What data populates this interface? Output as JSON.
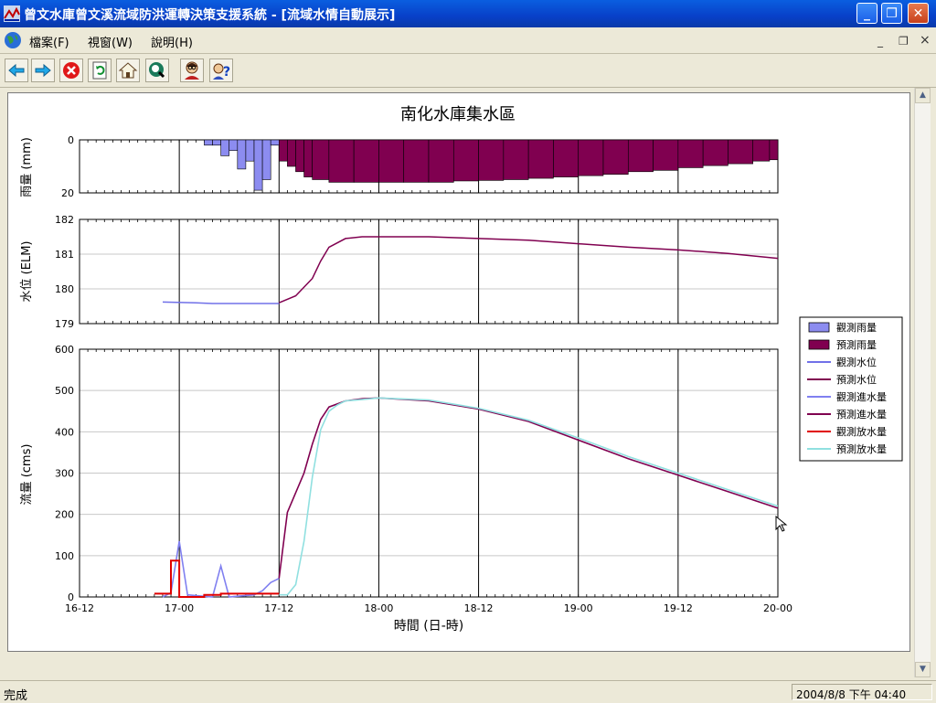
{
  "window": {
    "title": "曾文水庫曾文溪流域防洪運轉決策支援系統 - [流域水情自動展示]",
    "min_label": "_",
    "max_label": "❐",
    "close_label": "✕"
  },
  "menu": {
    "items": [
      "檔案(F)",
      "視窗(W)",
      "說明(H)"
    ],
    "mdi_min": "_",
    "mdi_restore": "❐",
    "mdi_close": "×"
  },
  "toolbar": {
    "buttons": [
      "back-icon",
      "forward-icon",
      "stop-icon",
      "refresh-icon",
      "home-icon",
      "search-icon",
      "user-icon",
      "help-icon"
    ]
  },
  "chart_data": [
    {
      "type": "bar",
      "title": "南化水庫集水區",
      "ylabel": "雨量 (mm)",
      "ylim": [
        20,
        0
      ],
      "yticks": [
        0,
        20
      ],
      "inverted": true,
      "xrange_hours": [
        0,
        84
      ],
      "series": [
        {
          "name": "觀測雨量",
          "color": "#8c8cf0",
          "x": [
            15,
            16,
            17,
            18,
            19,
            20,
            21,
            22,
            23
          ],
          "values": [
            2,
            2,
            6,
            4,
            11,
            8,
            19,
            15,
            2
          ]
        },
        {
          "name": "預測雨量",
          "color": "#800050",
          "x": [
            24,
            25,
            26,
            27,
            28,
            30,
            33,
            36,
            39,
            42,
            45,
            48,
            51,
            54,
            57,
            60,
            63,
            66,
            69,
            72,
            75,
            78,
            81,
            83
          ],
          "values": [
            8,
            10,
            12,
            14,
            15,
            16,
            16,
            16,
            16,
            16,
            15.5,
            15.3,
            15,
            14.5,
            14,
            13.5,
            13,
            12,
            11.5,
            10.5,
            9.7,
            9,
            8,
            7.5
          ]
        }
      ]
    },
    {
      "type": "line",
      "ylabel": "水位 (ELM)",
      "ylim": [
        179,
        182
      ],
      "yticks": [
        179,
        180,
        181,
        182
      ],
      "series": [
        {
          "name": "觀測水位",
          "color": "#7070e8",
          "points": [
            [
              10,
              179.62
            ],
            [
              14,
              179.6
            ],
            [
              16,
              179.58
            ],
            [
              24,
              179.58
            ]
          ]
        },
        {
          "name": "預測水位",
          "color": "#800050",
          "points": [
            [
              24,
              179.6
            ],
            [
              26,
              179.8
            ],
            [
              28,
              180.3
            ],
            [
              29,
              180.8
            ],
            [
              30,
              181.2
            ],
            [
              32,
              181.45
            ],
            [
              34,
              181.5
            ],
            [
              36,
              181.5
            ],
            [
              42,
              181.5
            ],
            [
              48,
              181.45
            ],
            [
              54,
              181.4
            ],
            [
              60,
              181.3
            ],
            [
              66,
              181.2
            ],
            [
              72,
              181.12
            ],
            [
              78,
              181.02
            ],
            [
              84,
              180.88
            ]
          ]
        }
      ]
    },
    {
      "type": "line",
      "ylabel": "流量 (cms)",
      "xlabel": "時間 (日-時)",
      "ylim": [
        0,
        600
      ],
      "yticks": [
        0,
        100,
        200,
        300,
        400,
        500,
        600
      ],
      "xticks": [
        0,
        12,
        24,
        36,
        48,
        60,
        72,
        84
      ],
      "xticklabels": [
        "16-12",
        "17-00",
        "17-12",
        "18-00",
        "18-12",
        "19-00",
        "19-12",
        "20-00"
      ],
      "series": [
        {
          "name": "觀測進水量",
          "color": "#8080f0",
          "points": [
            [
              10,
              0
            ],
            [
              11,
              10
            ],
            [
              12,
              135
            ],
            [
              13,
              5
            ],
            [
              16,
              0
            ],
            [
              17,
              75
            ],
            [
              18,
              0
            ],
            [
              21,
              5
            ],
            [
              22,
              15
            ],
            [
              23,
              35
            ],
            [
              24,
              45
            ]
          ]
        },
        {
          "name": "預測進水量",
          "color": "#800050",
          "points": [
            [
              24,
              45
            ],
            [
              25,
              205
            ],
            [
              27,
              300
            ],
            [
              28,
              370
            ],
            [
              29,
              430
            ],
            [
              30,
              460
            ],
            [
              32,
              475
            ],
            [
              34,
              480
            ],
            [
              36,
              482
            ],
            [
              42,
              475
            ],
            [
              48,
              455
            ],
            [
              54,
              425
            ],
            [
              60,
              380
            ],
            [
              66,
              335
            ],
            [
              72,
              295
            ],
            [
              78,
              255
            ],
            [
              84,
              215
            ]
          ]
        },
        {
          "name": "觀測放水量",
          "color": "#e00000",
          "points": [
            [
              9,
              8
            ],
            [
              11,
              8
            ],
            [
              11,
              88
            ],
            [
              12,
              88
            ],
            [
              12,
              0
            ],
            [
              15,
              0
            ],
            [
              15,
              5
            ],
            [
              17,
              5
            ],
            [
              17,
              8
            ],
            [
              24,
              8
            ]
          ]
        },
        {
          "name": "預測放水量",
          "color": "#90e0e0",
          "points": [
            [
              24,
              5
            ],
            [
              25,
              5
            ],
            [
              26,
              30
            ],
            [
              27,
              135
            ],
            [
              28,
              290
            ],
            [
              29,
              405
            ],
            [
              30,
              450
            ],
            [
              31,
              465
            ],
            [
              32,
              475
            ],
            [
              34,
              478
            ],
            [
              36,
              482
            ],
            [
              42,
              477
            ],
            [
              48,
              457
            ],
            [
              54,
              428
            ],
            [
              60,
              385
            ],
            [
              66,
              340
            ],
            [
              72,
              300
            ],
            [
              78,
              260
            ],
            [
              84,
              220
            ]
          ]
        }
      ]
    }
  ],
  "legend": {
    "entries": [
      {
        "name": "觀測雨量",
        "kind": "box",
        "color": "#8c8cf0"
      },
      {
        "name": "預測雨量",
        "kind": "box",
        "color": "#800050"
      },
      {
        "name": "觀測水位",
        "kind": "line",
        "color": "#7070e8"
      },
      {
        "name": "預測水位",
        "kind": "line",
        "color": "#800050"
      },
      {
        "name": "觀測進水量",
        "kind": "line",
        "color": "#8080f0"
      },
      {
        "name": "預測進水量",
        "kind": "line",
        "color": "#800050"
      },
      {
        "name": "觀測放水量",
        "kind": "line",
        "color": "#e00000"
      },
      {
        "name": "預測放水量",
        "kind": "line",
        "color": "#90e0e0"
      }
    ]
  },
  "status": {
    "left": "完成",
    "datetime": "2004/8/8 下午 04:40"
  }
}
